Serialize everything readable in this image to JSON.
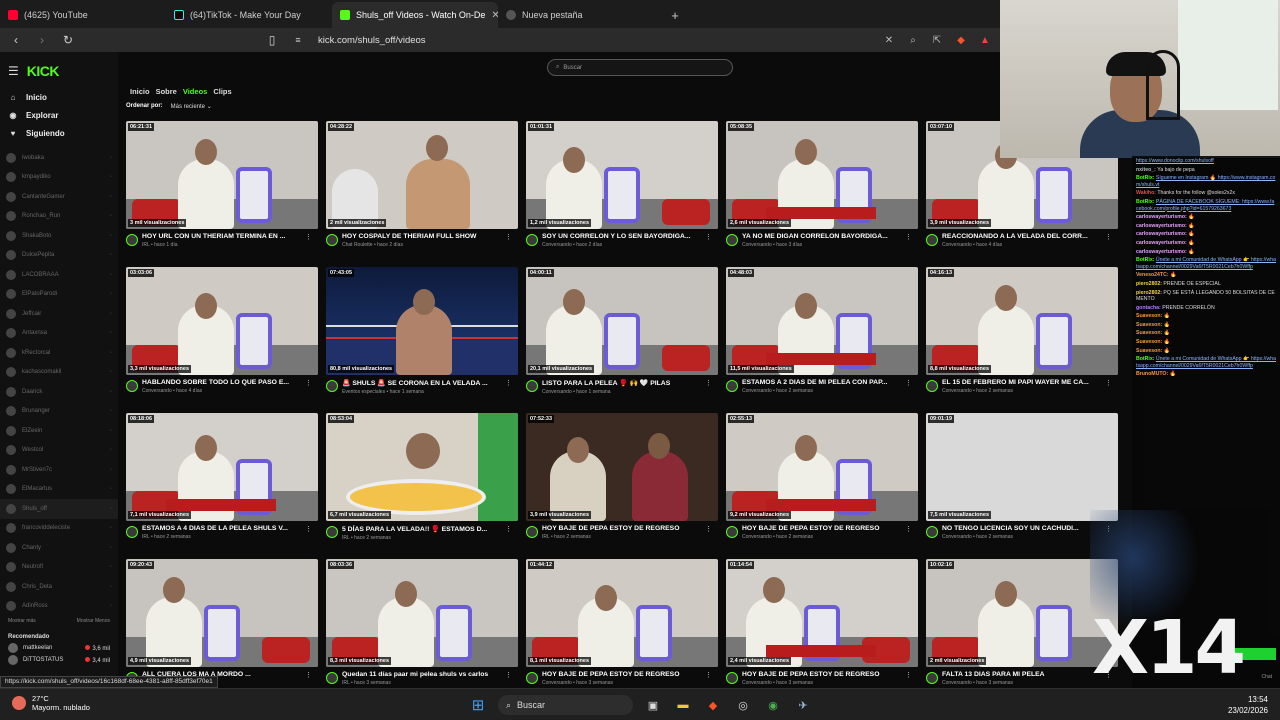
{
  "browser": {
    "tabs": [
      {
        "title": "(4625) YouTube",
        "color": "#ff0033"
      },
      {
        "title": "(64)TikTok - Make Your Day",
        "color": "#222222"
      },
      {
        "title": "Shuls_off Videos - Watch On-De",
        "color": "#53fc18"
      },
      {
        "title": "Nueva pestaña",
        "color": "#888888"
      }
    ],
    "url": "kick.com/shuls_off/videos"
  },
  "kick": {
    "logo": "KICK",
    "nav": [
      {
        "label": "Inicio",
        "icon": "home-icon",
        "glyph": "⌂"
      },
      {
        "label": "Explorar",
        "icon": "compass-icon",
        "glyph": "◉"
      },
      {
        "label": "Siguiendo",
        "icon": "heart-icon",
        "glyph": "♥"
      }
    ],
    "channels": [
      "iwobaka",
      "kmpaydiko",
      "CantanteGamer",
      "Ronchao_Run",
      "ShakaBoto",
      "DulcePepita",
      "LACOBRAAA",
      "ElPatoParodi",
      "Jeffcair",
      "Antaxnsa",
      "kRectorcal",
      "kachascomakil",
      "Daarick",
      "Brunanger",
      "ElZeein",
      "Westcol",
      "MrStiven7c",
      "ElMacartus",
      "Shuls_off",
      "francoviddeleciste",
      "Chanty",
      "Neutrofl",
      "Chris_Deta",
      "AdinRoss"
    ],
    "show_more": "Mostrar más",
    "show_less": "Mostrar Menos",
    "recommended_title": "Recomendado",
    "recommended": [
      {
        "name": "mattkeelan",
        "viewers": "3,6 mil"
      },
      {
        "name": "DiTTOSTATUS",
        "viewers": "3,4 mil"
      }
    ],
    "search_placeholder": "Buscar",
    "profile_tabs": [
      "Inicio",
      "Sobre",
      "Videos",
      "Clips"
    ],
    "sort_label": "Ordenar por:",
    "sort_value": "Más reciente",
    "videos": [
      {
        "duration": "06:21:31",
        "views": "3 mil visualizaciones",
        "title": "HOY URL CON UN THERIAM TERMINA EN ...",
        "category": "IRL",
        "ago": "hace 1 día",
        "scene": "room"
      },
      {
        "duration": "04:28:22",
        "views": "2 mil visualizaciones",
        "title": "HOY COSPALY DE THERIAM FULL SHOW",
        "category": "Chat Roulette",
        "ago": "hace 2 días",
        "scene": "cam"
      },
      {
        "duration": "01:01:31",
        "views": "1,2 mil visualizaciones",
        "title": "SOY UN CORRELON Y LO SEN BAYORDIGA...",
        "category": "Conversando",
        "ago": "hace 2 días",
        "scene": "room2"
      },
      {
        "duration": "05:08:35",
        "views": "2,6 mil visualizaciones",
        "title": "YA NO ME DIGAN CORRELON BAYORDIGA...",
        "category": "Conversando",
        "ago": "hace 3 días",
        "scene": "room"
      },
      {
        "duration": "03:07:10",
        "views": "3,9 mil visualizaciones",
        "title": "REACCIONANDO A LA VELADA DEL CORR...",
        "category": "Conversando",
        "ago": "hace 4 días",
        "scene": "room"
      },
      {
        "duration": "03:03:06",
        "views": "3,3 mil visualizaciones",
        "title": "HABLANDO SOBRE TODO LO QUE PASO E...",
        "category": "Conversando",
        "ago": "hace 4 días",
        "scene": "room"
      },
      {
        "duration": "07:43:05",
        "views": "80,8 mil visualizaciones",
        "title": "🚨 SHULS 🚨 SE CORONA EN LA VELADA ...",
        "category": "Eventos especiales",
        "ago": "hace 1 semana",
        "scene": "ring"
      },
      {
        "duration": "04:00:11",
        "views": "20,1 mil visualizaciones",
        "title": "LISTO PARA LA PELEA 🥊 🙌 🤍 PILAS",
        "category": "Conversando",
        "ago": "hace 1 semana",
        "scene": "room2"
      },
      {
        "duration": "04:48:03",
        "views": "11,5 mil visualizaciones",
        "title": "ESTAMOS A 2 DIAS DE MI PELEA CON PAP...",
        "category": "Conversando",
        "ago": "hace 2 semanas",
        "scene": "room"
      },
      {
        "duration": "04:16:13",
        "views": "8,8 mil visualizaciones",
        "title": "EL 15 DE FEBRERO MI PAPI WAYER ME CA...",
        "category": "Conversando",
        "ago": "hace 2 semanas",
        "scene": "room"
      },
      {
        "duration": "08:18:06",
        "views": "7,1 mil visualizaciones",
        "title": "ESTAMOS A 4 DIAS DE LA PELEA SHULS V...",
        "category": "IRL",
        "ago": "hace 2 semanas",
        "scene": "room"
      },
      {
        "duration": "08:53:04",
        "views": "6,7 mil visualizaciones",
        "title": "5 DÍAS PARA LA VELADA!! 🥊 ESTAMOS D...",
        "category": "IRL",
        "ago": "hace 2 semanas",
        "scene": "food"
      },
      {
        "duration": "07:52:33",
        "views": "3,9 mil visualizaciones",
        "title": "HOY BAJE DE PEPA ESTOY DE REGRESO",
        "category": "IRL",
        "ago": "hace 2 semanas",
        "scene": "car"
      },
      {
        "duration": "02:55:13",
        "views": "9,2 mil visualizaciones",
        "title": "HOY BAJE DE PEPA ESTOY DE REGRESO",
        "category": "Conversando",
        "ago": "hace 2 semanas",
        "scene": "room"
      },
      {
        "duration": "09:01:19",
        "views": "7,5 mil visualizaciones",
        "title": "NO TENGO LICENCIA SOY UN CACHUDI...",
        "category": "Conversando",
        "ago": "hace 2 semanas",
        "scene": "blank"
      },
      {
        "duration": "09:20:43",
        "views": "4,9 mil visualizaciones",
        "title": "ALL CUERA LOS MA A MORDO ...",
        "category": "IRL",
        "ago": "hace 3 semanas",
        "scene": "room2"
      },
      {
        "duration": "08:03:36",
        "views": "8,3 mil visualizaciones",
        "title": "Quedan 11 días paar mi pelea shuls vs carlos",
        "category": "IRL",
        "ago": "hace 3 semanas",
        "scene": "room"
      },
      {
        "duration": "01:44:12",
        "views": "8,1 mil visualizaciones",
        "title": "HOY BAJE DE PEPA ESTOY DE REGRESO",
        "category": "Conversando",
        "ago": "hace 3 semanas",
        "scene": "room"
      },
      {
        "duration": "01:14:54",
        "views": "2,4 mil visualizaciones",
        "title": "HOY BAJE DE PEPA ESTOY DE REGRESO",
        "category": "Conversando",
        "ago": "hace 3 semanas",
        "scene": "room2"
      },
      {
        "duration": "10:02:16",
        "views": "2 mil visualizaciones",
        "title": "FALTA 13 DIAS PARA MI PELEA",
        "category": "Conversando",
        "ago": "hace 3 semanas",
        "scene": "room"
      }
    ]
  },
  "chat": {
    "messages": [
      {
        "user": "",
        "text": "https://www.donoclip.com/shulsoff",
        "link": true,
        "color": "#8ab4ff"
      },
      {
        "user": "nxiteo_:",
        "text": "Ya bajo de pepa",
        "link": false,
        "color": "#bbbbbb"
      },
      {
        "user": "BotRix:",
        "text": "Sígueme en Instagram 🔥 https://www.instagram.com/shuls.vt",
        "link": true,
        "color": "#53fc18"
      },
      {
        "user": "Wakiho:",
        "text": "Thanks for the follow @soles2x2x",
        "link": false,
        "color": "#e14b4b"
      },
      {
        "user": "BotRix:",
        "text": "PÁGINA DE FACEBOOK SÍGUEME: https://www.facebook.com/profile.php?id=61579263673",
        "link": true,
        "color": "#53fc18"
      },
      {
        "user": "carloswayerturismo:",
        "text": "🔥",
        "link": false,
        "color": "#e7a1ff"
      },
      {
        "user": "carloswayerturismo:",
        "text": "🔥",
        "link": false,
        "color": "#e7a1ff"
      },
      {
        "user": "carloswayerturismo:",
        "text": "🔥",
        "link": false,
        "color": "#e7a1ff"
      },
      {
        "user": "carloswayerturismo:",
        "text": "🔥",
        "link": false,
        "color": "#e7a1ff"
      },
      {
        "user": "carloswayerturismo:",
        "text": "🔥",
        "link": false,
        "color": "#e7a1ff"
      },
      {
        "user": "BotRix:",
        "text": "Únete a mi Comunidad de WhatsApp 👉 https://whatsapp.com/channel/0029Va6fT5R0021Ceb7h0Wffp",
        "link": true,
        "color": "#53fc18"
      },
      {
        "user": "Veneso24TC:",
        "text": "🔥",
        "link": false,
        "color": "#f59a3d"
      },
      {
        "user": "piero2802:",
        "text": "PRENDE OE ESPECIAL",
        "link": false,
        "color": "#f5d23d"
      },
      {
        "user": "piero2802:",
        "text": "PQ SE ESTÁ LLEGANDO 50 BOLSITAS DE CEMENTO",
        "link": false,
        "color": "#f5d23d"
      },
      {
        "user": "gontacha:",
        "text": "PRENDE CORRELÓN",
        "link": false,
        "color": "#b27cff"
      },
      {
        "user": "Suaveson:",
        "text": "🔥",
        "link": false,
        "color": "#f59a3d"
      },
      {
        "user": "Suaveson:",
        "text": "🔥",
        "link": false,
        "color": "#f59a3d"
      },
      {
        "user": "Suaveson:",
        "text": "🔥",
        "link": false,
        "color": "#f59a3d"
      },
      {
        "user": "Suaveson:",
        "text": "🔥",
        "link": false,
        "color": "#f59a3d"
      },
      {
        "user": "Suaveson:",
        "text": "🔥",
        "link": false,
        "color": "#f59a3d"
      },
      {
        "user": "BotRix:",
        "text": "Únete a mi Comunidad de WhatsApp 👉 https://whatsapp.com/channel/0029Va6fT5R0021Ceb7h0Wffp",
        "link": true,
        "color": "#53fc18"
      },
      {
        "user": "BrunoMUTO:",
        "text": "🔥",
        "link": false,
        "color": "#f59a3d"
      }
    ],
    "send_label": "Chat",
    "overlay_text": "X14"
  },
  "status_link": "https://kick.com/shuls_off/videos/16c168df-68ee-4381-a8ff-85dff3ef70e1",
  "taskbar": {
    "temp": "27°C",
    "weather": "Mayorm. nublado",
    "search": "Buscar",
    "time": "13:54",
    "date": "23/02/2026"
  }
}
